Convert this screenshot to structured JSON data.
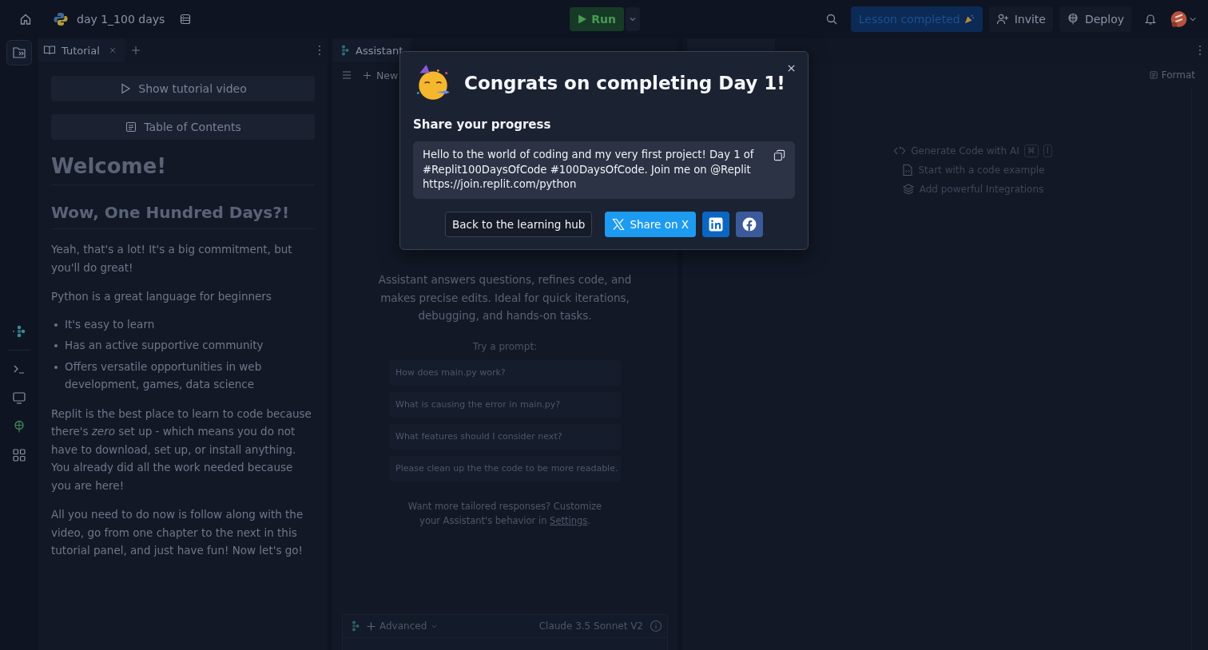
{
  "topbar": {
    "project": "day 1_100 days",
    "run": "Run",
    "lesson": "Lesson completed",
    "invite": "Invite",
    "deploy": "Deploy"
  },
  "tutorial": {
    "tab": "Tutorial",
    "buttons": [
      {
        "kind": "video",
        "label": "Show tutorial video"
      },
      {
        "kind": "contents",
        "label": "Table of Contents"
      }
    ],
    "title": "Welcome!",
    "heading": "Wow, One Hundred Days?!",
    "blocks": [
      {
        "kind": "p",
        "text": "Yeah, that's a lot! It's a big commitment, but you'll do great!"
      },
      {
        "kind": "p",
        "text": "Python is a great language for beginners"
      },
      {
        "kind": "list",
        "items": [
          "It's easy to learn",
          "Has an active supportive community",
          "Offers versatile opportunities in web development, games, data science"
        ]
      },
      {
        "kind": "p",
        "text": "Replit is the best place to learn to code because there's *zero* set up - which means you do not have to download, set up, or install anything. You already did all the work needed because you are here!"
      },
      {
        "kind": "p",
        "text": "All you need to do now is follow along with the video, go from one chapter to the next in this tutorial panel, and just have fun! Now let's go!"
      }
    ]
  },
  "assistant": {
    "tab": "Assistant",
    "new": "New",
    "intro": "Assistant answers questions, refines code, and makes precise edits. Ideal for quick iterations, debugging, and hands-on tasks.",
    "try": "Try a prompt:",
    "prompts": [
      "How does main.py work?",
      "What is causing the error in main.py?",
      "What features should I consider next?",
      "Please clean up the the code to be more readable."
    ],
    "customize": "Want more tailored responses? Customize your Assistant's behavior in",
    "settings": "Settings",
    "period": ".",
    "mode": "Advanced",
    "model": "Claude 3.5 Sonnet V2"
  },
  "editor": {
    "format": "Format",
    "actions": [
      {
        "kind": "generate",
        "label": "Generate Code with AI",
        "keys": [
          "⌘",
          "I"
        ]
      },
      {
        "kind": "example",
        "label": "Start with a code example"
      },
      {
        "kind": "integrations",
        "label": "Add powerful Integrations"
      }
    ]
  },
  "modal": {
    "title": "Congrats on completing Day 1!",
    "subtitle": "Share your progress",
    "message": "Hello to the world of coding and my very first project! Day 1 of #Replit100DaysOfCode #100DaysOfCode. Join me on @Replit https://join.replit.com/python",
    "buttons": [
      {
        "kind": "back",
        "label": "Back to the learning hub"
      },
      {
        "kind": "x",
        "label": "Share on X"
      },
      {
        "kind": "linkedin"
      },
      {
        "kind": "facebook"
      }
    ]
  }
}
